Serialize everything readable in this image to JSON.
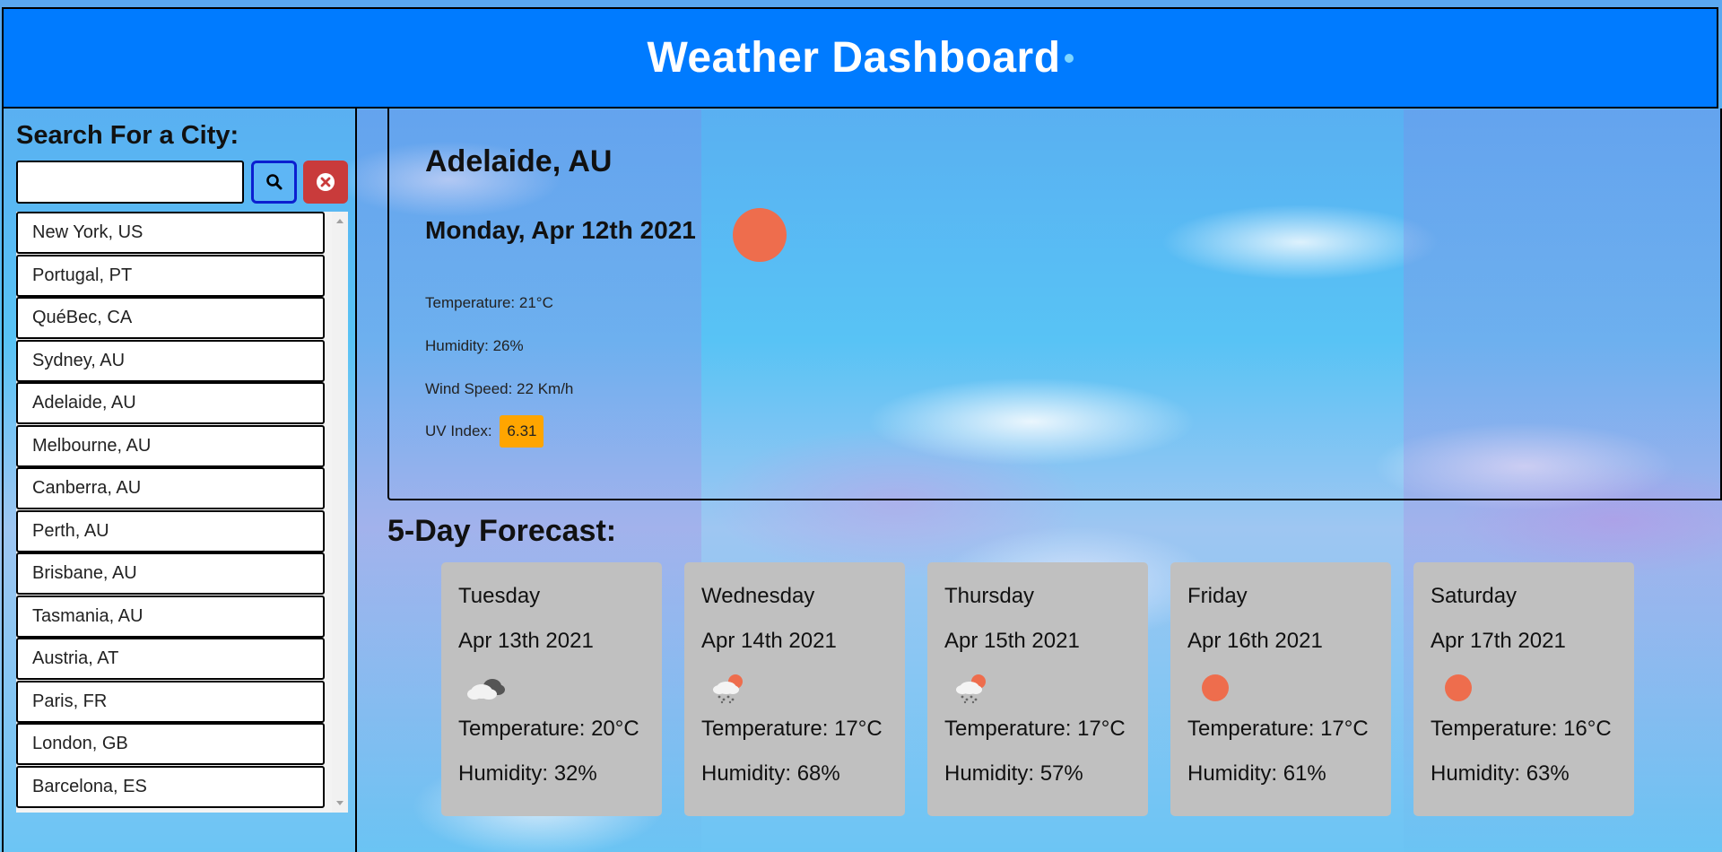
{
  "header": {
    "title": "Weather Dashboard"
  },
  "sidebar": {
    "search_label": "Search For a City:",
    "search_value": "",
    "search_button_icon": "search-icon",
    "clear_button_icon": "times-circle-icon",
    "cities": [
      "New York, US",
      "Portugal, PT",
      "QuéBec, CA",
      "Sydney, AU",
      "Adelaide, AU",
      "Melbourne, AU",
      "Canberra, AU",
      "Perth, AU",
      "Brisbane, AU",
      "Tasmania, AU",
      "Austria, AT",
      "Paris, FR",
      "London, GB",
      "Barcelona, ES"
    ]
  },
  "current": {
    "city": "Adelaide, AU",
    "date": "Monday, Apr 12th 2021",
    "icon": "sun-icon",
    "temperature": "Temperature: 21°C",
    "humidity": "Humidity: 26%",
    "wind": "Wind Speed: 22 Km/h",
    "uv_label": "UV Index:",
    "uv_value": "6.31",
    "uv_color": "#ffa500"
  },
  "forecast": {
    "title": "5-Day Forecast:",
    "days": [
      {
        "day": "Tuesday",
        "date": "Apr 13th 2021",
        "icon": "cloud-icon",
        "temp": "Temperature: 20°C",
        "humidity": "Humidity: 32%"
      },
      {
        "day": "Wednesday",
        "date": "Apr 14th 2021",
        "icon": "snow-cloud-icon",
        "temp": "Temperature: 17°C",
        "humidity": "Humidity: 68%"
      },
      {
        "day": "Thursday",
        "date": "Apr 15th 2021",
        "icon": "snow-cloud-icon",
        "temp": "Temperature: 17°C",
        "humidity": "Humidity: 57%"
      },
      {
        "day": "Friday",
        "date": "Apr 16th 2021",
        "icon": "sun-icon",
        "temp": "Temperature: 17°C",
        "humidity": "Humidity: 61%"
      },
      {
        "day": "Saturday",
        "date": "Apr 17th 2021",
        "icon": "sun-icon",
        "temp": "Temperature: 16°C",
        "humidity": "Humidity: 63%"
      }
    ]
  },
  "colors": {
    "header": "#007bff",
    "sun": "#ee6d4d",
    "card": "#c0c0c0",
    "clear_button": "#c93b3b"
  }
}
